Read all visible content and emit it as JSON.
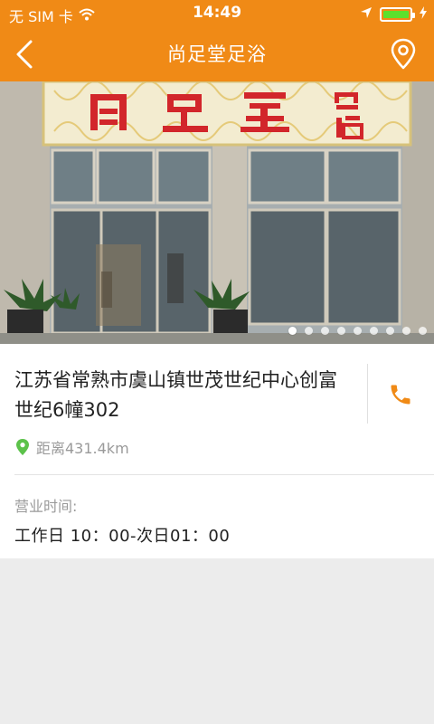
{
  "status_bar": {
    "carrier": "无 SIM 卡",
    "time": "14:49",
    "battery_level": 1.0,
    "colors": {
      "background": "#f08a16",
      "battery_fill": "#5be02d"
    }
  },
  "nav": {
    "title": "尚足堂足浴",
    "back_icon": "chevron-left-icon",
    "location_icon": "map-pin-icon"
  },
  "banner": {
    "slide_count": 9,
    "active_slide": 1
  },
  "detail": {
    "address": "江苏省常熟市虞山镇世茂世纪中心创富世纪6幢302",
    "distance": "距离431.4km",
    "hours_label": "营业时间:",
    "hours_value": "工作日 10：00-次日01：00",
    "accent_color": "#f08a16",
    "pin_color": "#5cc24a"
  }
}
